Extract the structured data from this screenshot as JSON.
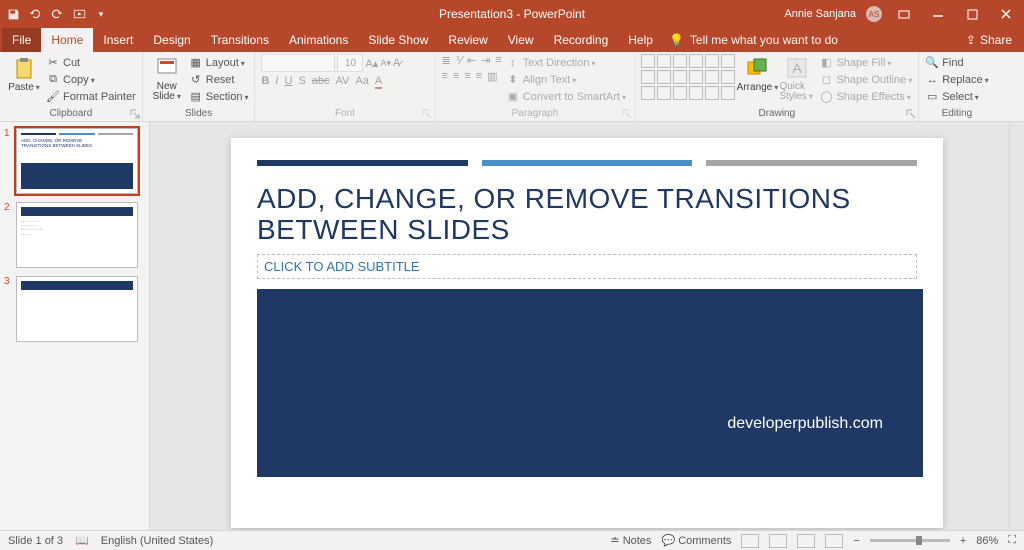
{
  "title": {
    "doc": "Presentation3",
    "app": "PowerPoint"
  },
  "user": {
    "name": "Annie Sanjana",
    "initials": "AS"
  },
  "tabs": {
    "file": "File",
    "home": "Home",
    "insert": "Insert",
    "design": "Design",
    "transitions": "Transitions",
    "animations": "Animations",
    "slideshow": "Slide Show",
    "review": "Review",
    "view": "View",
    "recording": "Recording",
    "help": "Help",
    "tellme": "Tell me what you want to do",
    "share": "Share"
  },
  "ribbon": {
    "clipboard": {
      "label": "Clipboard",
      "paste": "Paste",
      "cut": "Cut",
      "copy": "Copy",
      "format_painter": "Format Painter"
    },
    "slides": {
      "label": "Slides",
      "new_slide": "New Slide",
      "layout": "Layout",
      "reset": "Reset",
      "section": "Section"
    },
    "font": {
      "label": "Font",
      "name": "",
      "size": "10"
    },
    "paragraph": {
      "label": "Paragraph",
      "text_direction": "Text Direction",
      "align_text": "Align Text",
      "smartart": "Convert to SmartArt"
    },
    "drawing": {
      "label": "Drawing",
      "arrange": "Arrange",
      "quick_styles": "Quick Styles",
      "shape_fill": "Shape Fill",
      "shape_outline": "Shape Outline",
      "shape_effects": "Shape Effects"
    },
    "editing": {
      "label": "Editing",
      "find": "Find",
      "replace": "Replace",
      "select": "Select"
    }
  },
  "thumbs": {
    "n1": "1",
    "n2": "2",
    "n3": "3",
    "t1": "ADD, CHANGE, OR REMOVE TRANSITIONS BETWEEN SLIDES"
  },
  "slide": {
    "title": "ADD, CHANGE, OR REMOVE TRANSITIONS BETWEEN SLIDES",
    "subtitle_placeholder": "CLICK TO ADD SUBTITLE",
    "watermark": "developerpublish.com"
  },
  "status": {
    "slide_info": "Slide 1 of 3",
    "language": "English (United States)",
    "notes": "Notes",
    "comments": "Comments",
    "zoom": "86%"
  }
}
